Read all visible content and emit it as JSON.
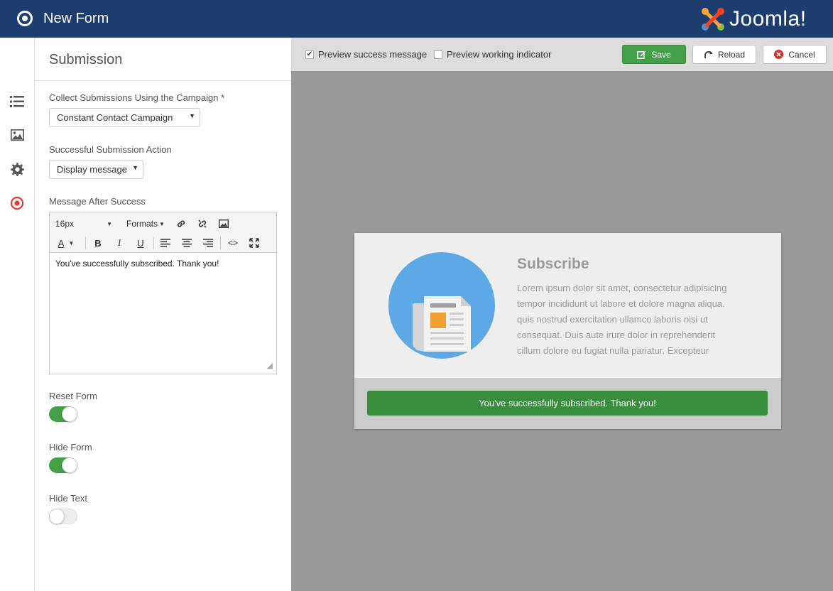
{
  "header": {
    "title": "New Form",
    "brand": "Joomla!"
  },
  "rail": {
    "items": [
      "list-icon",
      "image-icon",
      "gear-icon",
      "target-icon"
    ],
    "active_color": "#e53935"
  },
  "panel": {
    "title": "Submission",
    "campaign_label": "Collect Submissions Using the Campaign *",
    "campaign_value": "Constant Contact Campaign",
    "action_label": "Successful Submission Action",
    "action_value": "Display message",
    "message_label": "Message After Success",
    "editor": {
      "font_size": "16px",
      "formats": "Formats",
      "content": "You've successfully subscribed. Thank you!"
    },
    "reset_form_label": "Reset Form",
    "reset_form_on": true,
    "hide_form_label": "Hide Form",
    "hide_form_on": true,
    "hide_text_label": "Hide Text",
    "hide_text_on": false
  },
  "preview_bar": {
    "preview_success_label": "Preview success message",
    "preview_success_checked": true,
    "preview_working_label": "Preview working indicator",
    "preview_working_checked": false,
    "save_label": "Save",
    "reload_label": "Reload",
    "cancel_label": "Cancel"
  },
  "form_preview": {
    "title": "Subscribe",
    "text": "Lorem ipsum dolor sit amet, consectetur adipisicing tempor incididunt ut labore et dolore magna aliqua. quis nostrud exercitation ullamco laboris nisi ut consequat. Duis aute irure dolor in reprehenderit cillum dolore eu fugiat nulla pariatur. Excepteur",
    "success_message": "You've successfully subscribed. Thank you!"
  },
  "colors": {
    "header": "#1c3d6e",
    "accent_green": "#43a047",
    "canvas": "#999999"
  }
}
